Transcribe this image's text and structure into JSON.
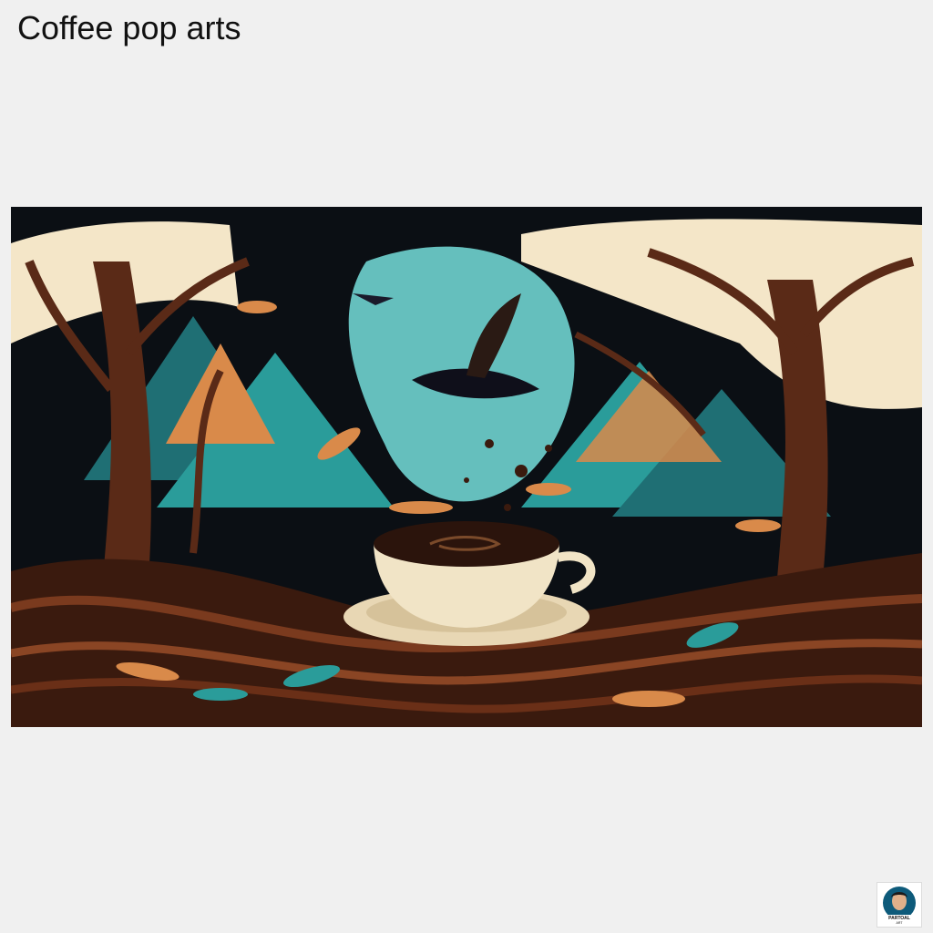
{
  "page": {
    "title": "Coffee pop arts"
  },
  "artwork": {
    "subject": "coffee-cup-forest-illustration",
    "colors": {
      "background": "#0b0f14",
      "cream": "#f4e6c8",
      "teal": "#2a9c9a",
      "light_teal": "#6fd3cf",
      "brown": "#5a2a17",
      "orange": "#d98a4a",
      "coffee": "#2b140c"
    }
  },
  "logo": {
    "icon": "portrait-logo-icon",
    "text": "PARTOAL ART"
  }
}
